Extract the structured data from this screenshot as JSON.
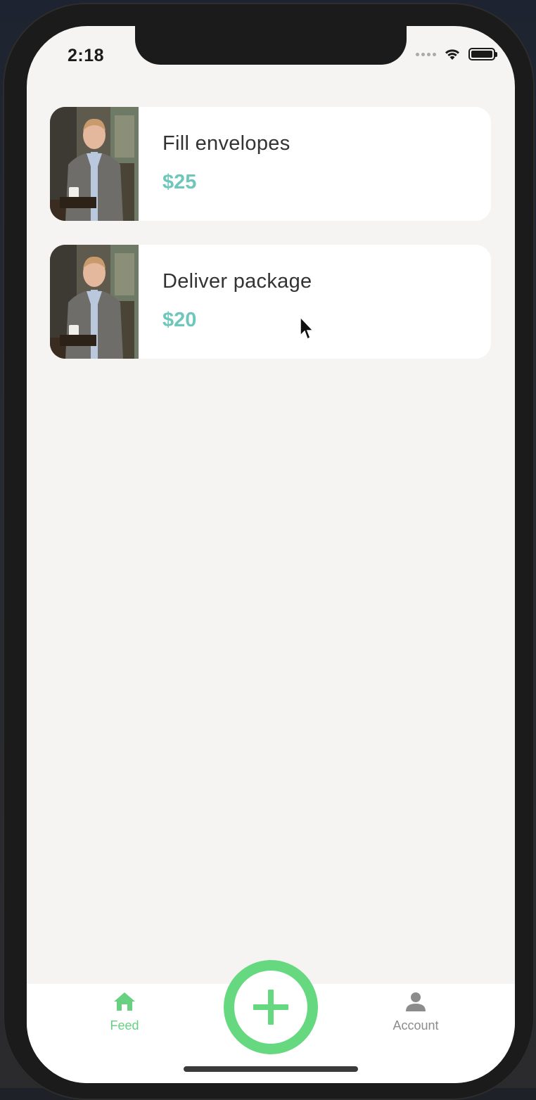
{
  "status_bar": {
    "time": "2:18",
    "signal_icon": "cellular-signal-icon",
    "wifi_icon": "wifi-icon",
    "battery_icon": "battery-icon"
  },
  "feed": {
    "items": [
      {
        "title": "Fill envelopes",
        "price": "$25",
        "photo": "profile-photo"
      },
      {
        "title": "Deliver package",
        "price": "$20",
        "photo": "profile-photo"
      }
    ]
  },
  "tab_bar": {
    "feed_label": "Feed",
    "account_label": "Account",
    "add_icon": "plus-icon",
    "active_tab": "Feed"
  },
  "colors": {
    "accent_green": "#66d980",
    "price_teal": "#6fc7bc",
    "inactive_gray": "#8c8c8c",
    "background": "#f5f4f3"
  }
}
